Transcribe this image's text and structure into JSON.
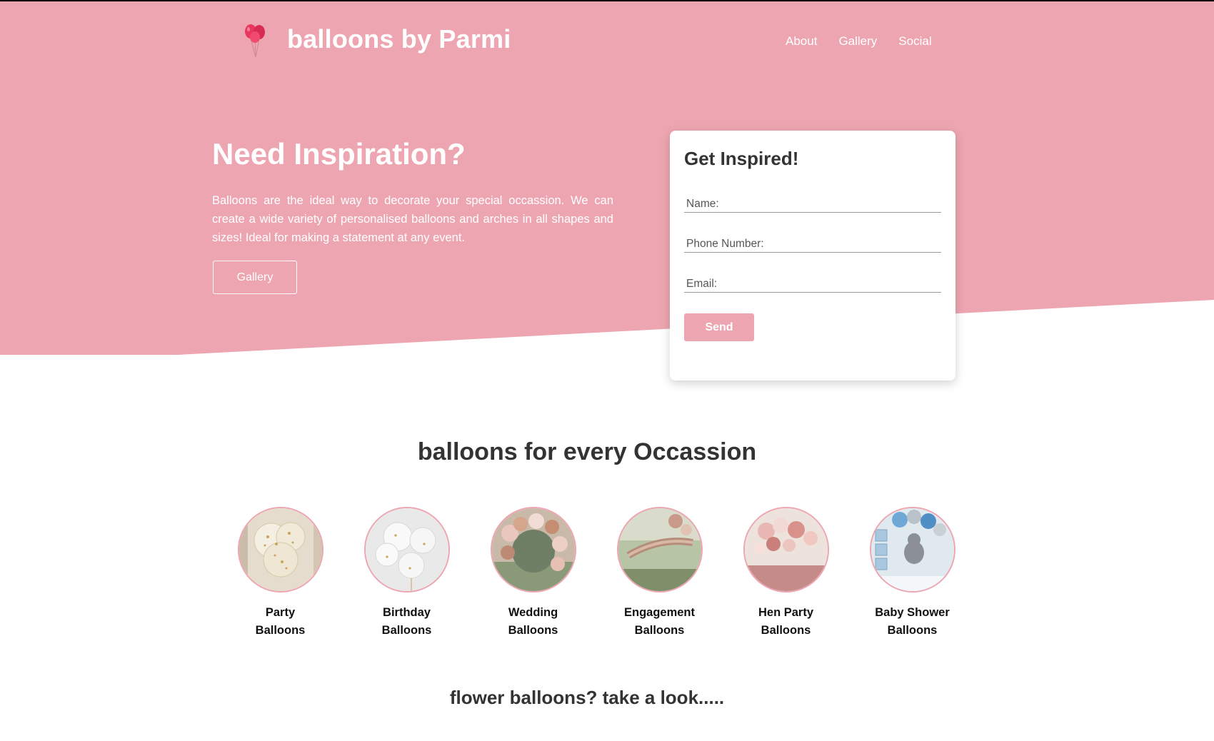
{
  "colors": {
    "brand_pink": "#eda6b1",
    "text_dark": "#333333",
    "white": "#ffffff"
  },
  "header": {
    "logo_icon": "balloon-icon",
    "brand": "balloons by Parmi",
    "nav": [
      "About",
      "Gallery",
      "Social"
    ]
  },
  "hero": {
    "title": "Need Inspiration?",
    "text": "Balloons are the ideal way to decorate your special occassion. We can create a wide variety of personalised balloons and arches in all shapes and sizes! Ideal for making a statement at any event.",
    "button": "Gallery"
  },
  "form": {
    "title": "Get Inspired!",
    "name_placeholder": "Name:",
    "phone_placeholder": "Phone Number:",
    "email_placeholder": "Email:",
    "send": "Send"
  },
  "occasions": {
    "title": "balloons for every Occassion",
    "items": [
      {
        "line1": "Party",
        "line2": "Balloons"
      },
      {
        "line1": "Birthday",
        "line2": "Balloons"
      },
      {
        "line1": "Wedding",
        "line2": "Balloons"
      },
      {
        "line1": "Engagement",
        "line2": "Balloons"
      },
      {
        "line1": "Hen Party",
        "line2": "Balloons"
      },
      {
        "line1": "Baby Shower",
        "line2": "Balloons"
      }
    ]
  },
  "flower": {
    "title": "flower balloons? take a look....."
  }
}
